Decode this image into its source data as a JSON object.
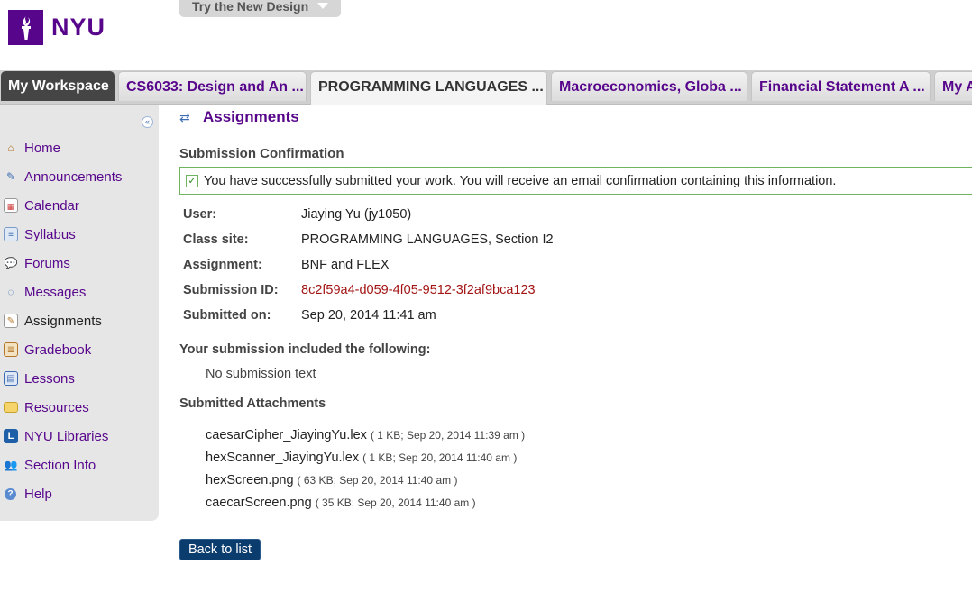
{
  "header": {
    "logo_text": "NYU",
    "try_design_label": "Try the New Design"
  },
  "tabs": [
    {
      "label": "My Workspace"
    },
    {
      "label": "CS6033: Design and An ..."
    },
    {
      "label": "PROGRAMMING LANGUAGES ...",
      "current": true
    },
    {
      "label": "Macroeconomics, Globa ..."
    },
    {
      "label": "Financial Statement A ..."
    },
    {
      "label": "My A"
    }
  ],
  "sidebar": {
    "items": [
      {
        "label": "Home",
        "icon": "home-icon"
      },
      {
        "label": "Announcements",
        "icon": "megaphone-icon"
      },
      {
        "label": "Calendar",
        "icon": "calendar-icon"
      },
      {
        "label": "Syllabus",
        "icon": "syllabus-icon"
      },
      {
        "label": "Forums",
        "icon": "forums-icon"
      },
      {
        "label": "Messages",
        "icon": "messages-icon"
      },
      {
        "label": "Assignments",
        "icon": "assignments-icon",
        "active": true
      },
      {
        "label": "Gradebook",
        "icon": "gradebook-icon"
      },
      {
        "label": "Lessons",
        "icon": "lessons-icon"
      },
      {
        "label": "Resources",
        "icon": "folder-icon"
      },
      {
        "label": "NYU Libraries",
        "icon": "library-icon"
      },
      {
        "label": "Section Info",
        "icon": "section-info-icon"
      },
      {
        "label": "Help",
        "icon": "help-icon"
      }
    ]
  },
  "main": {
    "tool_title": "Assignments",
    "confirmation_heading": "Submission Confirmation",
    "success_message": "You have successfully submitted your work. You will receive an email confirmation containing this information.",
    "info": {
      "user_label": "User:",
      "user_value": "Jiaying Yu (jy1050)",
      "class_label": "Class site:",
      "class_value": "PROGRAMMING LANGUAGES, Section I2",
      "assignment_label": "Assignment:",
      "assignment_value": "BNF and FLEX",
      "submission_id_label": "Submission ID:",
      "submission_id_value": "8c2f59a4-d059-4f05-9512-3f2af9bca123",
      "submitted_on_label": "Submitted on:",
      "submitted_on_value": "Sep 20, 2014 11:41 am"
    },
    "included_heading": "Your submission included the following:",
    "no_submission_text": "No submission text",
    "attachments_heading": "Submitted Attachments",
    "attachments": [
      {
        "name": "caesarCipher_JiayingYu.lex",
        "meta": "( 1 KB; Sep 20, 2014 11:39 am )"
      },
      {
        "name": "hexScanner_JiayingYu.lex",
        "meta": "( 1 KB; Sep 20, 2014 11:40 am )"
      },
      {
        "name": "hexScreen.png",
        "meta": "( 63 KB; Sep 20, 2014 11:40 am )"
      },
      {
        "name": "caecarScreen.png",
        "meta": "( 35 KB; Sep 20, 2014 11:40 am )"
      }
    ],
    "back_button_label": "Back to list"
  },
  "colors": {
    "brand": "#57068c",
    "success_border": "#6fb35f",
    "submission_id": "#a31515",
    "button": "#0b3c6e"
  }
}
